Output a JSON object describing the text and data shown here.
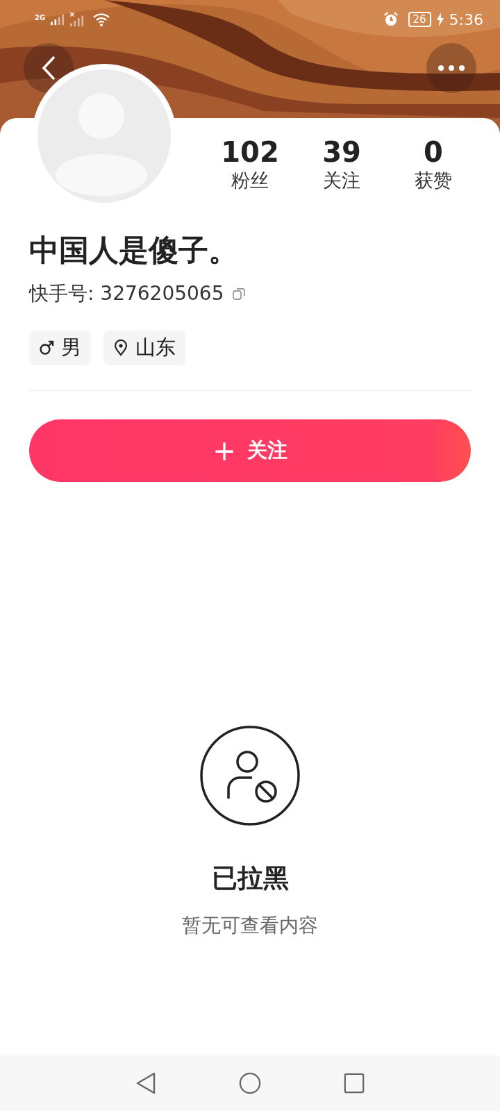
{
  "status_bar": {
    "network": "2G",
    "battery": "26",
    "time": "5:36"
  },
  "profile": {
    "name": "中国人是傻子。",
    "id_label": "快手号: 3276205065",
    "stats": [
      {
        "value": "102",
        "label": "粉丝"
      },
      {
        "value": "39",
        "label": "关注"
      },
      {
        "value": "0",
        "label": "获赞"
      }
    ],
    "tags": [
      {
        "kind": "gender",
        "text": "男"
      },
      {
        "kind": "location",
        "text": "山东"
      }
    ]
  },
  "follow_button": {
    "icon": "+",
    "label": "关注"
  },
  "blocked": {
    "title": "已拉黑",
    "message": "暂无可查看内容"
  }
}
